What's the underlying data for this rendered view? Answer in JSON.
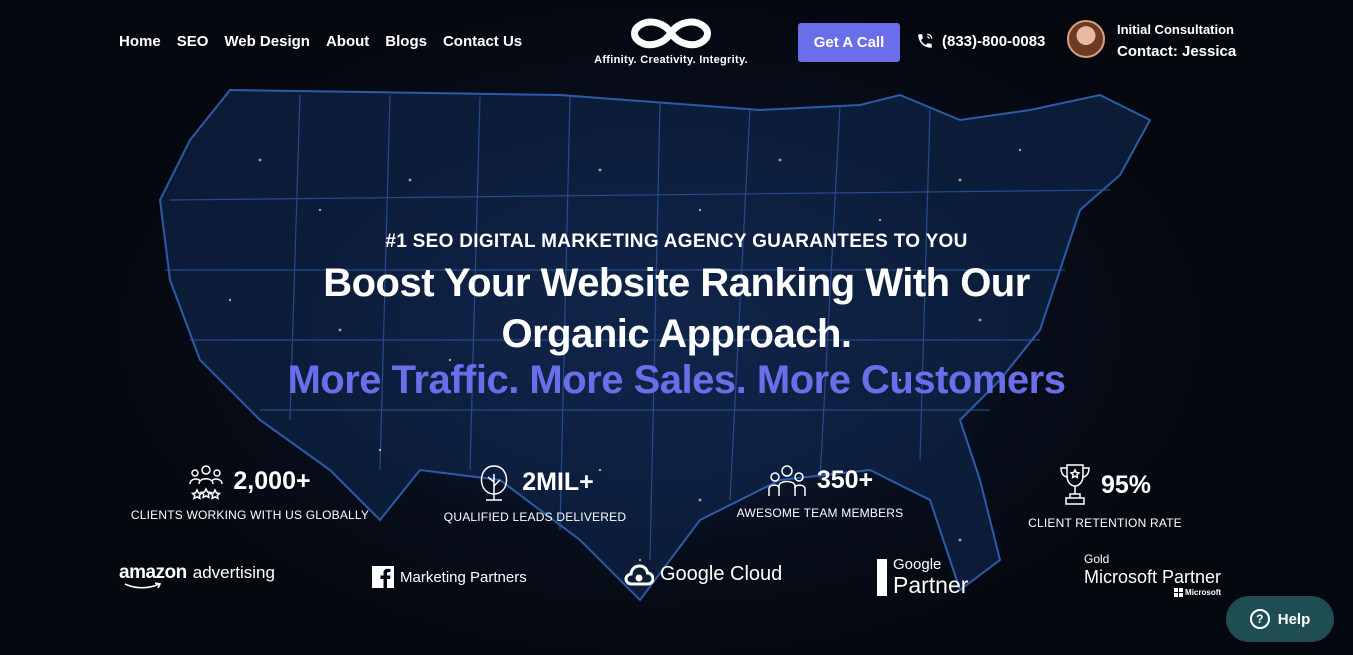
{
  "nav": {
    "items": [
      {
        "label": "Home"
      },
      {
        "label": "SEO"
      },
      {
        "label": "Web Design"
      },
      {
        "label": "About"
      },
      {
        "label": "Blogs"
      },
      {
        "label": "Contact Us"
      }
    ]
  },
  "logo": {
    "tagline": "Affinity. Creativity. Integrity."
  },
  "header": {
    "cta_label": "Get A Call",
    "phone": "(833)-800-0083",
    "consult_line1": "Initial Consultation",
    "consult_line2": "Contact: Jessica"
  },
  "hero": {
    "eyebrow": "#1 SEO DIGITAL MARKETING AGENCY GUARANTEES TO YOU",
    "headline_line1": "Boost Your Website Ranking With Our",
    "headline_line2": "Organic Approach.",
    "subhead": "More Traffic. More Sales. More Customers",
    "accent_color": "#6a6ee8"
  },
  "stats": [
    {
      "value": "2,000+",
      "label": "CLIENTS WORKING WITH US GLOBALLY",
      "icon": "users-stars-icon"
    },
    {
      "value": "2MIL+",
      "label": "QUALIFIED LEADS DELIVERED",
      "icon": "tree-icon"
    },
    {
      "value": "350+",
      "label": "AWESOME TEAM MEMBERS",
      "icon": "team-icon"
    },
    {
      "value": "95%",
      "label": "CLIENT RETENTION RATE",
      "icon": "trophy-icon"
    }
  ],
  "partners": {
    "amazon_word": "amazon",
    "amazon_suffix": "advertising",
    "facebook": "Marketing Partners",
    "google_cloud": "Google Cloud",
    "google_partner_top": "Google",
    "google_partner_bottom": "Partner",
    "microsoft_top": "Gold",
    "microsoft_main": "Microsoft Partner",
    "microsoft_small": "Microsoft"
  },
  "help": {
    "label": "Help"
  }
}
